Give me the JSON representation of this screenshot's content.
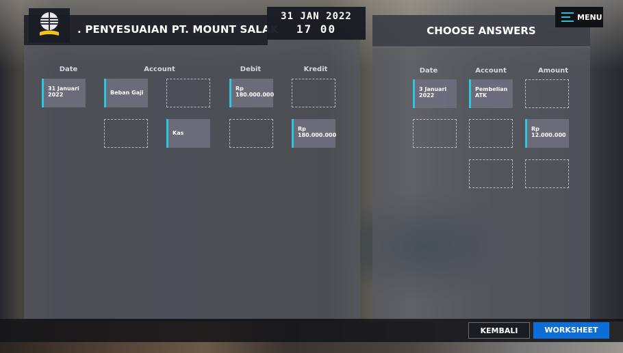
{
  "header": {
    "title": ". PENYESUAIAN PT. MOUNT SALAK",
    "date": "31 JAN 2022",
    "time": "17 00"
  },
  "right_panel": {
    "title": "CHOOSE ANSWERS"
  },
  "menu": {
    "label": "MENU",
    "icon": "hamburger-icon"
  },
  "journal": {
    "headers": {
      "date": "Date",
      "account": "Account",
      "debit": "Debit",
      "kredit": "Kredit"
    },
    "cards": {
      "date1": [
        "31 Januari",
        "2022"
      ],
      "account1": "Beban Gaji",
      "debit1": [
        "Rp",
        "180.000.000"
      ],
      "account2": "Kas",
      "kredit2": [
        "Rp",
        "180.000.000"
      ]
    }
  },
  "answers": {
    "headers": {
      "date": "Date",
      "account": "Account",
      "amount": "Amount"
    },
    "cards": {
      "date": [
        "3 Januari",
        "2022"
      ],
      "account": [
        "Pembelian",
        "ATK"
      ],
      "amount": [
        "Rp",
        "12.000.000"
      ]
    }
  },
  "buttons": {
    "kembali": "KEMBALI",
    "worksheet": "WORKSHEET"
  },
  "colors": {
    "accent": "#2ec7e0",
    "worksheet_button": "#0e6ed8"
  }
}
